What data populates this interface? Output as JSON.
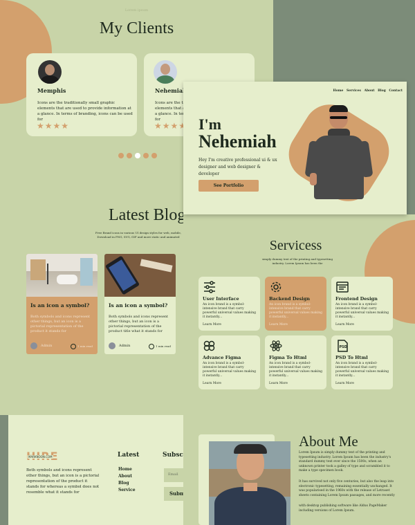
{
  "clients": {
    "eyebrow": "Lorem ipsum",
    "title": "My Clients",
    "cards": [
      {
        "name": "Memphis",
        "text": "Icons are the traditionally small graphic elements that are used to provide information at a glance. In terms of branding, icons can be used for"
      },
      {
        "name": "Nehemiah",
        "text": "Icons are the traditionally small graphic elements that are used to provide information at a glance. In terms of branding, icons can be used for"
      }
    ],
    "rating": 4,
    "dots_active": 2
  },
  "hero": {
    "nav": [
      "Home",
      "Services",
      "About",
      "Blog",
      "Contact"
    ],
    "line1": "I'm",
    "line2": "Nehemiah",
    "subtitle": "Hey I'm  creative professional ui & ux designer and  web designer & developer",
    "cta": "See Portfolio"
  },
  "blog": {
    "title": "Latest Blog",
    "subtitle": "Free Brand icons in various UI design styles for web, mobile, Download in PNG, SVG, GIF and more static and animated",
    "posts": [
      {
        "title": "Is an icon a symbol?",
        "text": "Both symbols and icons represent other things, but an icon is a pictorial representation of the product it stands for",
        "author": "Admin",
        "time": "1 min read"
      },
      {
        "title": "Is an icon a symbol?",
        "text": "Both symbols and icons represent other things, but an icon is a pictorial representation of the product title what it stands for",
        "author": "Admin",
        "time": "1 min read"
      }
    ]
  },
  "services": {
    "title": "Servicess",
    "subtitle": "simply dummy text of the printing and typesetting industry. Lorem Ipsum has been the",
    "items": [
      {
        "title": "User Interface",
        "icon": "sliders-icon",
        "text": "An icon brand is a symbol-intensive brand that carry powerful universal values making it instantly...",
        "link": "Learn More"
      },
      {
        "title": "Backend Design",
        "icon": "gear-icon",
        "text": "An icon brand is a symbol-intensive brand that carry powerful universal values making it instantly...",
        "link": "Learn More"
      },
      {
        "title": "Frontend Design",
        "icon": "browser-icon",
        "text": "An icon brand is a symbol-intensive brand that carry powerful universal values making it instantly...",
        "link": "Learn More"
      },
      {
        "title": "Advance Figma",
        "icon": "figma-icon",
        "text": "An icon brand is a symbol-intensive brand that carry powerful universal values making it instantly...",
        "link": "Learn More"
      },
      {
        "title": "Figma To Html",
        "icon": "atom-icon",
        "text": "An icon brand is a symbol-intensive brand that carry powerful universal values making it instantly...",
        "link": "Learn More"
      },
      {
        "title": "PSD To Html",
        "icon": "psd-file-icon",
        "text": "An icon brand is a symbol-intensive brand that carry powerful universal values making it instantly...",
        "link": "Learn More"
      }
    ],
    "highlight_index": 1
  },
  "footer": {
    "logo_big": "HIRE",
    "logo_site": "MARKNOON.COM",
    "about": "Both symbols and icons represent other things, but an icon is a pictorial representation of the product it stands for whereas a symbol does not resemble what it stands for",
    "latest_heading": "Latest",
    "links": [
      "Home",
      "About",
      "Blog",
      "Service"
    ],
    "subscribe_heading": "Subscribe",
    "email_placeholder": "Email",
    "submit": "Submit"
  },
  "about": {
    "title": "About Me",
    "p1": "Lorem Ipsum is simply dummy text of the printing and typesetting industry. Lorem Ipsum has been the industry's standard dummy text ever since the 1500s, when an unknown printer took a galley of type and scrambled it to make a type specimen book.",
    "p2": "It has survived not only five centuries, but also the leap into electronic typesetting, remaining essentially unchanged. It was popularised in the 1960s with the release of Letraset sheets containing Lorem Ipsum passages, and more recently",
    "p3": "with desktop publishing software like Aldus PageMaker including versions of Lorem Ipsum."
  },
  "colors": {
    "bg": "#7c8c79",
    "panel": "#c8d4a8",
    "card": "#e6eecc",
    "accent": "#d3a06d",
    "text": "#1e2a1e"
  }
}
